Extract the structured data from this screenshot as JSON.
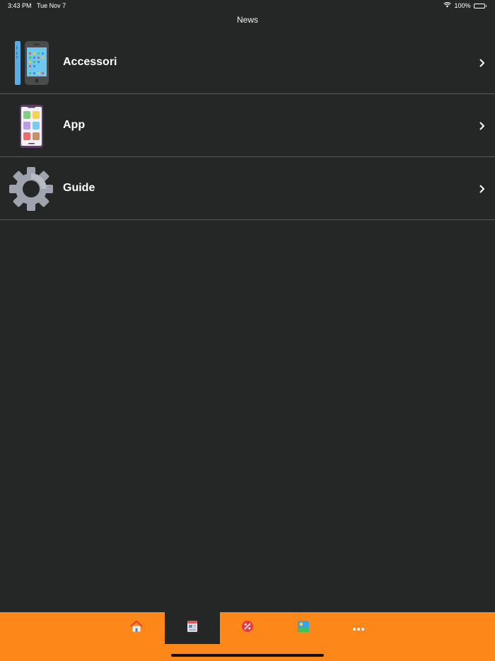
{
  "status_bar": {
    "time": "3:43 PM",
    "date": "Tue Nov 7",
    "battery_text": "100%",
    "battery_level": 1.0,
    "wifi_icon": "wifi-icon"
  },
  "nav": {
    "title": "News"
  },
  "list": {
    "items": [
      {
        "label": "Accessori",
        "icon": "phone-accessory-icon"
      },
      {
        "label": "App",
        "icon": "smartphone-apps-icon"
      },
      {
        "label": "Guide",
        "icon": "gear-icon"
      }
    ],
    "chevron_icon": "chevron-right-icon"
  },
  "tab_bar": {
    "background": "#fd8719",
    "selected_index": 1,
    "tabs": [
      {
        "icon": "home-icon"
      },
      {
        "icon": "news-icon"
      },
      {
        "icon": "discount-icon"
      },
      {
        "icon": "wallpaper-icon"
      },
      {
        "icon": "more-icon"
      }
    ]
  },
  "colors": {
    "background": "#252626",
    "separator": "#5a5a5a",
    "accent": "#fd8719"
  }
}
